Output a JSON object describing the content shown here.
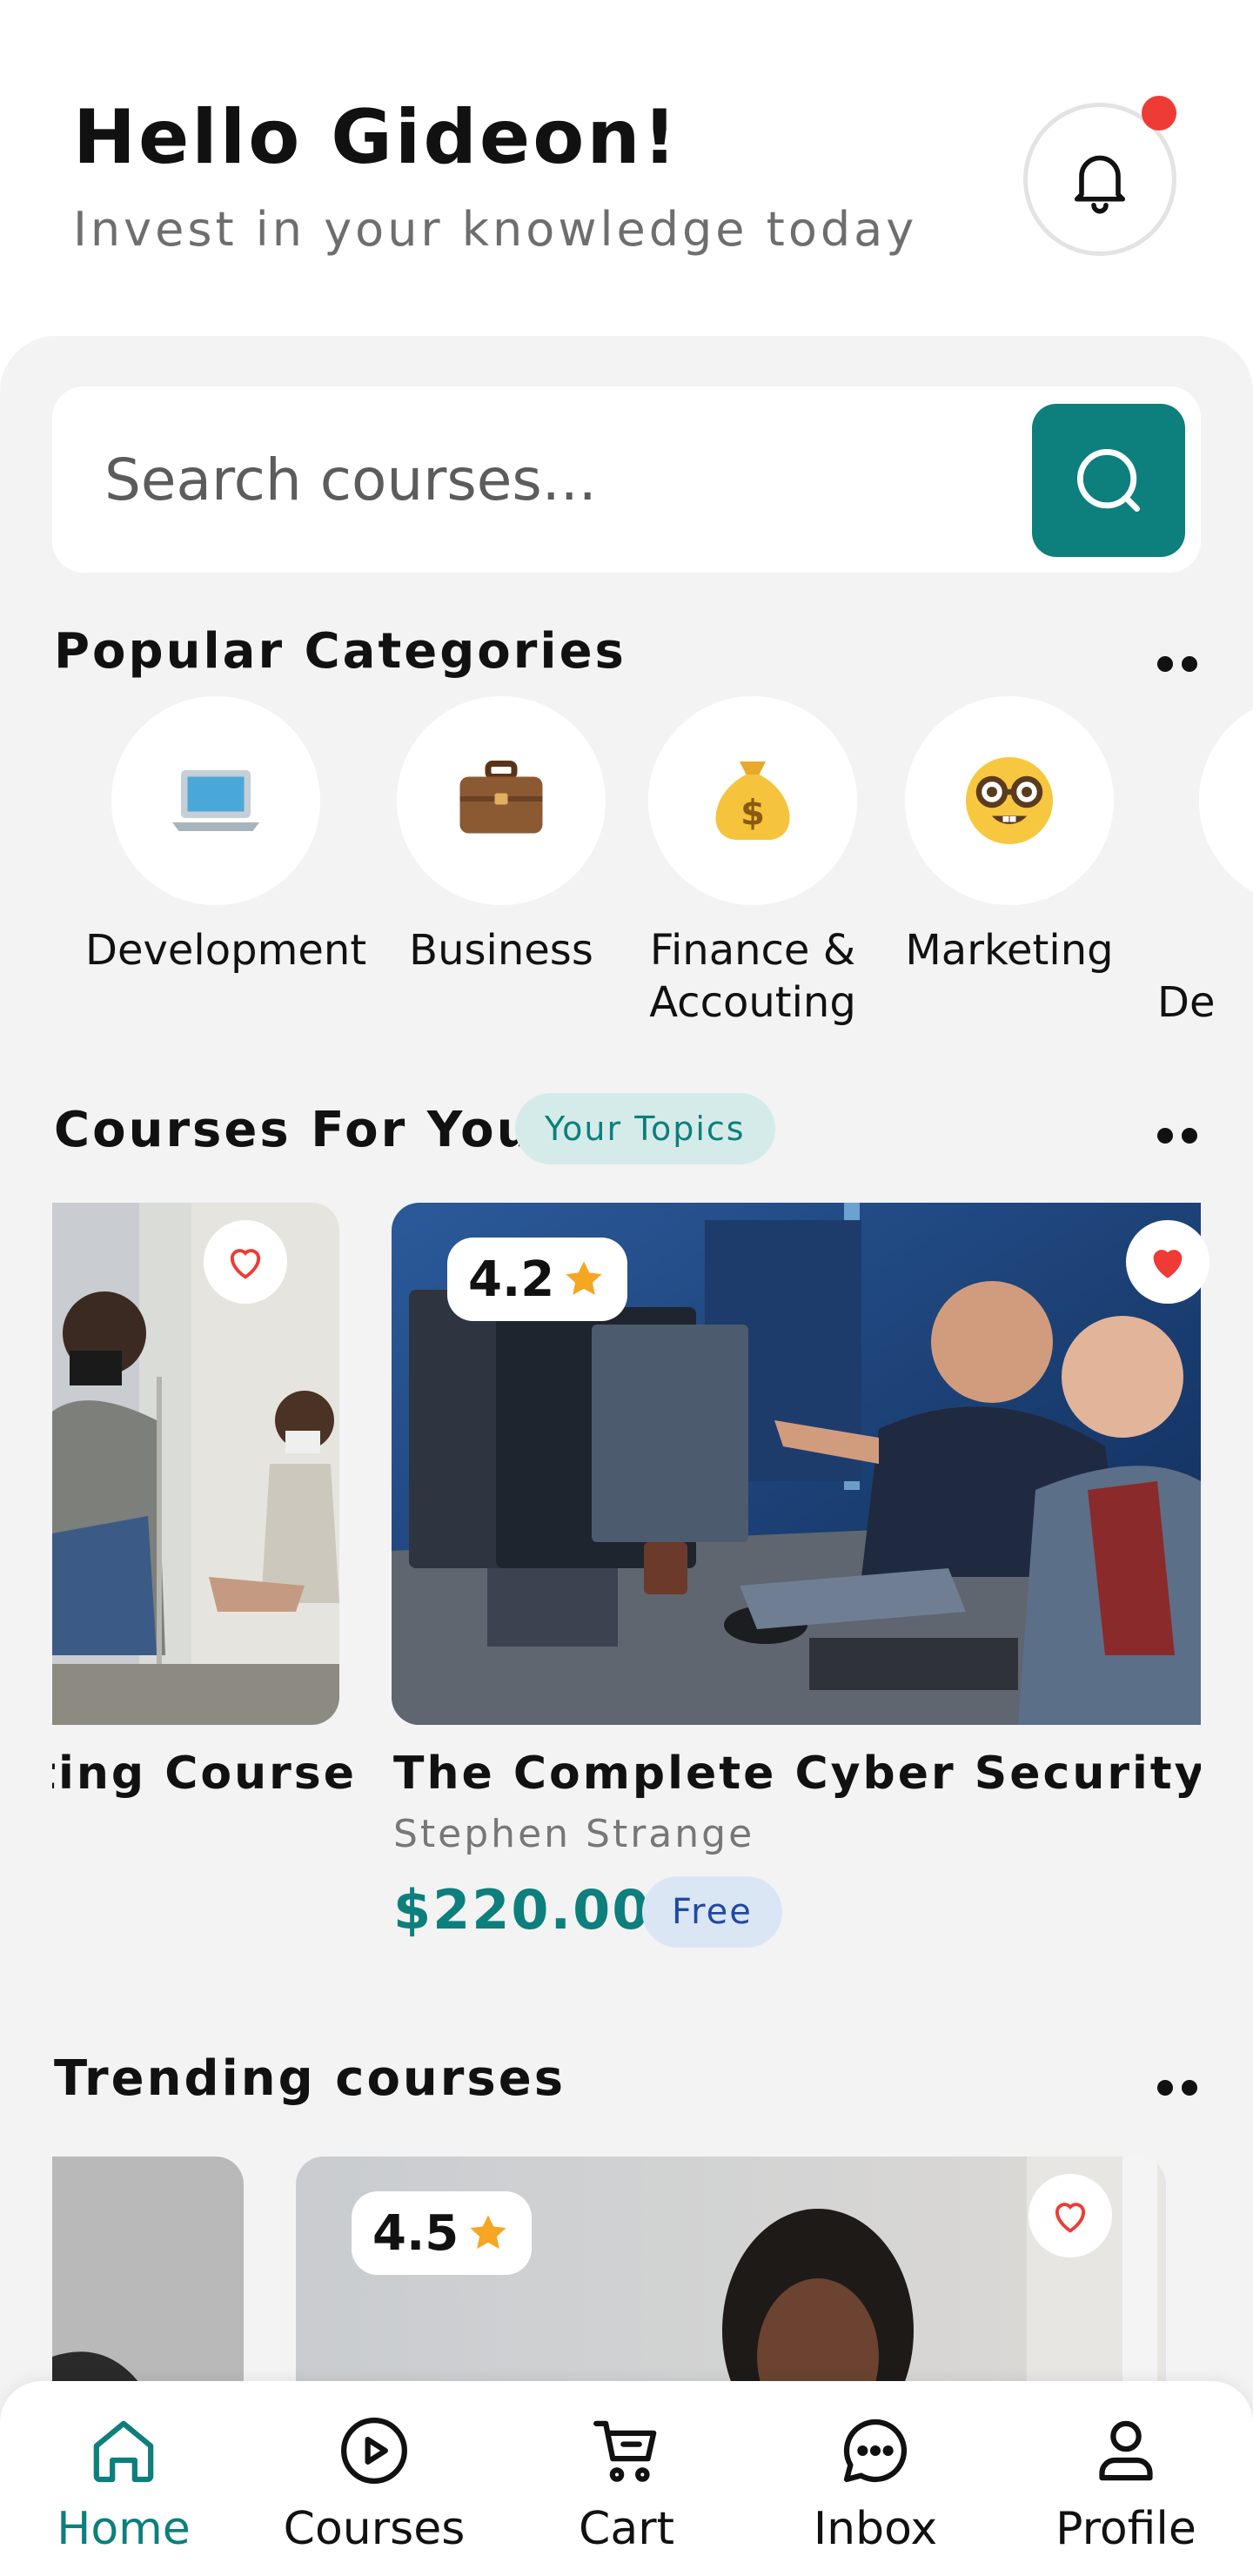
{
  "header": {
    "greeting": "Hello Gideon!",
    "subtitle": "Invest in your knowledge today"
  },
  "search": {
    "placeholder": "Search courses..."
  },
  "categories": {
    "title": "Popular Categories",
    "items": [
      {
        "label": "Development",
        "icon": "laptop-icon",
        "emoji": "💻"
      },
      {
        "label": "Business",
        "icon": "briefcase-icon",
        "emoji": "💼"
      },
      {
        "label": "Finance &",
        "label2": "Accouting",
        "icon": "money-bag-icon",
        "emoji": "💰"
      },
      {
        "label": "Marketing",
        "icon": "nerd-face-icon",
        "emoji": "🤓"
      },
      {
        "label": "De",
        "icon": "partial-category"
      }
    ]
  },
  "courses_for_you": {
    "title": "Courses For You",
    "chip": "Your Topics",
    "cards": [
      {
        "title": "nting Course",
        "liked": false
      },
      {
        "title": "The Complete Cyber Security Cou",
        "author": "Stephen Strange",
        "price": "$220.00",
        "badge": "Free",
        "rating": "4.2",
        "liked": true
      }
    ]
  },
  "trending": {
    "title": "Trending courses",
    "cards": [
      {
        "liked": true
      },
      {
        "rating": "4.5",
        "liked": false
      }
    ]
  },
  "nav": {
    "items": [
      {
        "label": "Home",
        "icon": "home-icon",
        "active": true
      },
      {
        "label": "Courses",
        "icon": "play-circle-icon",
        "active": false
      },
      {
        "label": "Cart",
        "icon": "cart-icon",
        "active": false
      },
      {
        "label": "Inbox",
        "icon": "chat-icon",
        "active": false
      },
      {
        "label": "Profile",
        "icon": "user-icon",
        "active": false
      }
    ]
  },
  "colors": {
    "accent": "#0d7f7c",
    "notification": "#ef3b35",
    "heart": "#ef3b35",
    "star": "#f5a623"
  }
}
